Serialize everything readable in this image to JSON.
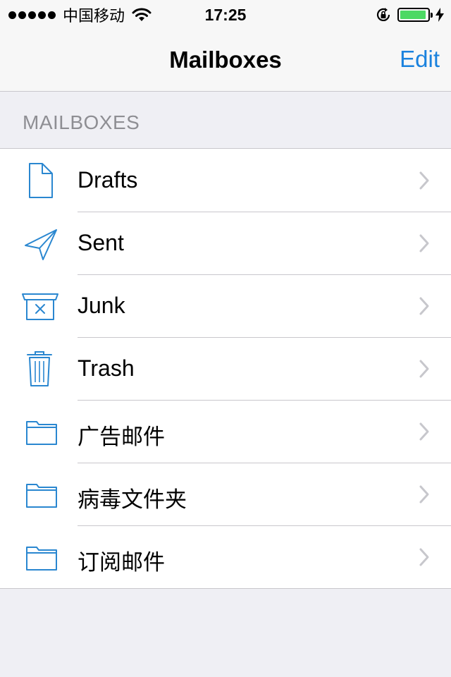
{
  "status_bar": {
    "carrier": "中国移动",
    "time": "17:25",
    "battery_level": 0.95
  },
  "nav": {
    "title": "Mailboxes",
    "edit_label": "Edit"
  },
  "section_header": "MAILBOXES",
  "mailboxes": [
    {
      "label": "Drafts",
      "icon": "document-icon"
    },
    {
      "label": "Sent",
      "icon": "paper-plane-icon"
    },
    {
      "label": "Junk",
      "icon": "junk-bin-icon"
    },
    {
      "label": "Trash",
      "icon": "trash-icon"
    },
    {
      "label": "广告邮件",
      "icon": "folder-icon"
    },
    {
      "label": "病毒文件夹",
      "icon": "folder-icon"
    },
    {
      "label": "订阅邮件",
      "icon": "folder-icon"
    }
  ],
  "colors": {
    "accent": "#1a82de",
    "icon": "#2a87d0",
    "background": "#efeff4",
    "battery": "#4cd964"
  }
}
